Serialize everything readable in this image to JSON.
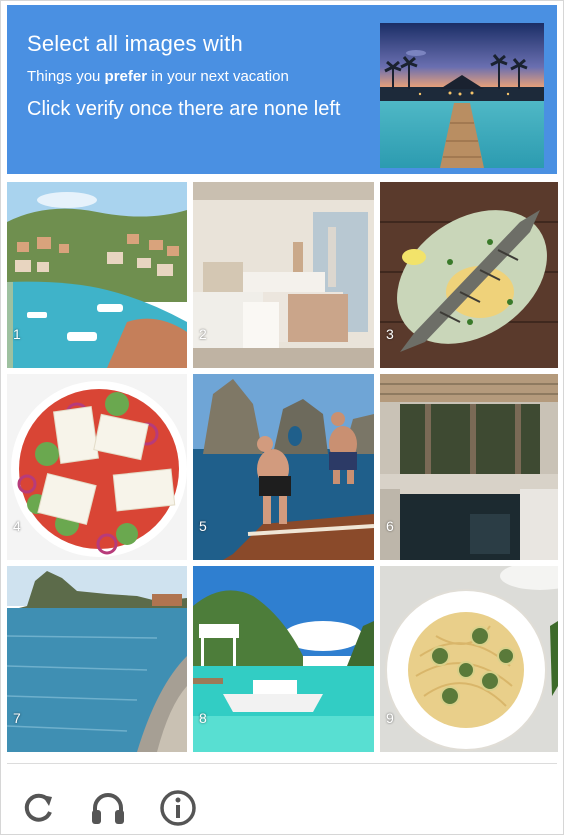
{
  "header": {
    "title": "Select all images with",
    "subtitle_prefix": "Things you ",
    "subtitle_bold": "prefer",
    "subtitle_suffix": " in your next vacation",
    "instruction": "Click verify once there are none left"
  },
  "tiles": [
    {
      "number": "1",
      "subject": "harbor town"
    },
    {
      "number": "2",
      "subject": "hotel room"
    },
    {
      "number": "3",
      "subject": "grilled fish"
    },
    {
      "number": "4",
      "subject": "greek salad"
    },
    {
      "number": "5",
      "subject": "cliff jumping"
    },
    {
      "number": "6",
      "subject": "villa pool"
    },
    {
      "number": "7",
      "subject": "pebble beach"
    },
    {
      "number": "8",
      "subject": "tropical lagoon"
    },
    {
      "number": "9",
      "subject": "pasta zucchini"
    }
  ],
  "footer": {
    "icons": [
      "refresh-icon",
      "headphones-icon",
      "info-icon"
    ]
  },
  "colors": {
    "header_bg": "#4a90e2",
    "icon": "#555555"
  }
}
